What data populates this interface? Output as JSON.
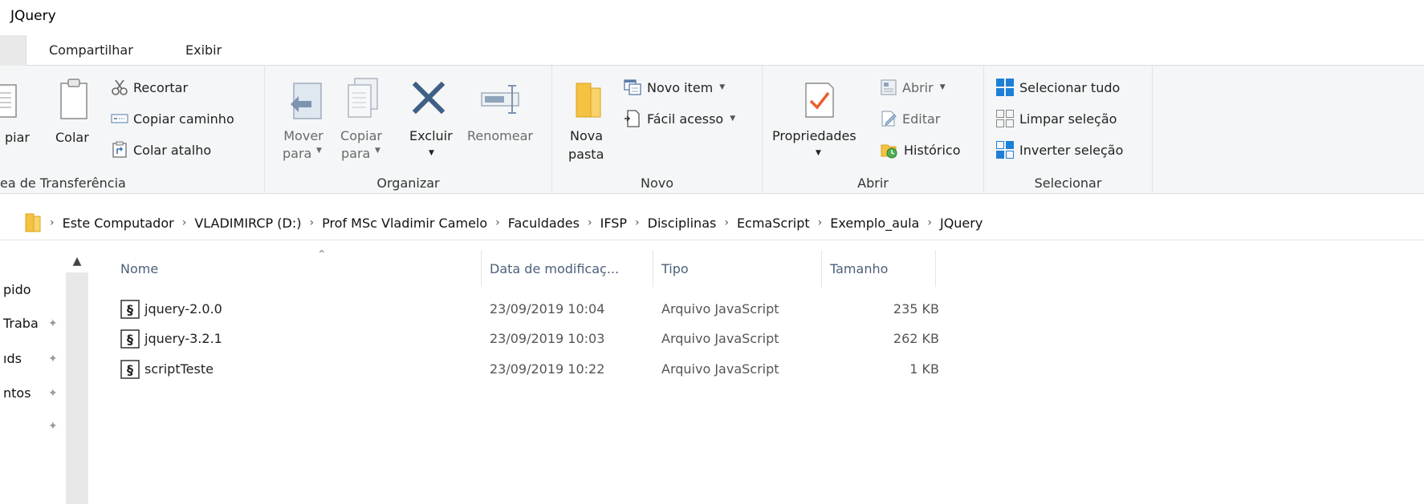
{
  "window": {
    "title": "JQuery"
  },
  "tabs": [
    "Compartilhar",
    "Exibir"
  ],
  "ribbon": {
    "clipboard": {
      "label": "ea de Transferência",
      "copy": "piar",
      "paste": "Colar",
      "cut": "Recortar",
      "copy_path": "Copiar caminho",
      "paste_shortcut": "Colar atalho"
    },
    "organize": {
      "label": "Organizar",
      "move_to_line1": "Mover",
      "move_to_line2": "para",
      "copy_to_line1": "Copiar",
      "copy_to_line2": "para",
      "delete": "Excluir",
      "rename": "Renomear"
    },
    "new": {
      "label": "Novo",
      "new_folder_line1": "Nova",
      "new_folder_line2": "pasta",
      "new_item": "Novo item",
      "easy_access": "Fácil acesso"
    },
    "open": {
      "label": "Abrir",
      "properties": "Propriedades",
      "open": "Abrir",
      "edit": "Editar",
      "history": "Histórico"
    },
    "select": {
      "label": "Selecionar",
      "select_all": "Selecionar tudo",
      "select_none": "Limpar seleção",
      "invert_selection": "Inverter seleção"
    }
  },
  "breadcrumb": [
    "Este Computador",
    "VLADIMIRCP (D:)",
    "Prof MSc Vladimir Camelo",
    "Faculdades",
    "IFSP",
    "Disciplinas",
    "EcmaScript",
    "Exemplo_aula",
    "JQuery"
  ],
  "nav": {
    "items": [
      "pido",
      "Traba",
      "ıds",
      "ntos"
    ]
  },
  "columns": {
    "name": "Nome",
    "date": "Data de modificaç...",
    "type": "Tipo",
    "size": "Tamanho"
  },
  "files": [
    {
      "name": "jquery-2.0.0",
      "date": "23/09/2019 10:04",
      "type": "Arquivo JavaScript",
      "size": "235 KB"
    },
    {
      "name": "jquery-3.2.1",
      "date": "23/09/2019 10:03",
      "type": "Arquivo JavaScript",
      "size": "262 KB"
    },
    {
      "name": "scriptTeste",
      "date": "23/09/2019 10:22",
      "type": "Arquivo JavaScript",
      "size": "1 KB"
    }
  ],
  "colors": {
    "accent": "#0a64c8",
    "folder": "#f5c242",
    "header_text": "#4c607a",
    "ribbon_bg": "#f5f6f7"
  }
}
